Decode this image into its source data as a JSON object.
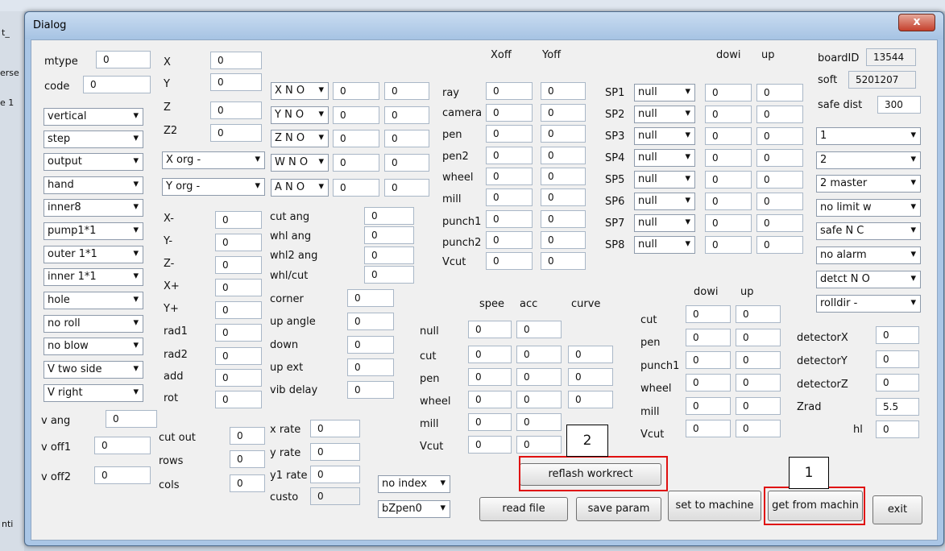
{
  "dialog": {
    "title": "Dialog",
    "close_glyph": "x"
  },
  "background": {
    "left_texts": [
      "t_",
      "erse",
      "e 1",
      "nti"
    ]
  },
  "colors": {
    "highlight": "#e01010"
  },
  "col1": {
    "mtype_label": "mtype",
    "mtype_value": "0",
    "code_label": "code",
    "code_value": "0",
    "combos": [
      "vertical",
      "step",
      "output",
      "hand",
      "inner8",
      "pump1*1",
      "outer 1*1",
      "inner 1*1",
      "hole",
      "no roll",
      "no blow",
      "V two side",
      "V right"
    ],
    "v_ang_label": "v ang",
    "v_ang_value": "0",
    "v_off1_label": "v off1",
    "v_off1_value": "0",
    "v_off2_label": "v off2",
    "v_off2_value": "0"
  },
  "col2": {
    "x_label": "X",
    "x_value": "0",
    "y_label": "Y",
    "y_value": "0",
    "z_label": "Z",
    "z_value": "0",
    "z2_label": "Z2",
    "z2_value": "0",
    "x_org": "X org -",
    "y_org": "Y org -",
    "rows": [
      {
        "label": "X-",
        "value": "0"
      },
      {
        "label": "Y-",
        "value": "0"
      },
      {
        "label": "Z-",
        "value": "0"
      },
      {
        "label": "X+",
        "value": "0"
      },
      {
        "label": "Y+",
        "value": "0"
      },
      {
        "label": "rad1",
        "value": "0"
      },
      {
        "label": "rad2",
        "value": "0"
      },
      {
        "label": "add",
        "value": "0"
      },
      {
        "label": "rot",
        "value": "0"
      }
    ],
    "cut_out_label": "cut out",
    "cut_out_value": "0",
    "rows_label": "rows",
    "rows_value": "0",
    "cols_label": "cols",
    "cols_value": "0"
  },
  "col3": {
    "no_rows": [
      {
        "combo": "X N O",
        "a": "0",
        "b": "0"
      },
      {
        "combo": "Y N O",
        "a": "0",
        "b": "0"
      },
      {
        "combo": "Z N O",
        "a": "0",
        "b": "0"
      },
      {
        "combo": "W N O",
        "a": "0",
        "b": "0"
      },
      {
        "combo": "A N O",
        "a": "0",
        "b": "0"
      }
    ],
    "angles": [
      {
        "label": "cut ang",
        "value": "0"
      },
      {
        "label": "whl ang",
        "value": "0"
      },
      {
        "label": "whl2 ang",
        "value": "0"
      },
      {
        "label": "whl/cut",
        "value": "0"
      }
    ],
    "params": [
      {
        "label": "corner",
        "value": "0"
      },
      {
        "label": "up angle",
        "value": "0"
      },
      {
        "label": "down",
        "value": "0"
      },
      {
        "label": "up ext",
        "value": "0"
      },
      {
        "label": "vib delay",
        "value": "0"
      }
    ],
    "x_rate_label": "x rate",
    "x_rate_value": "0",
    "y_rate_label": "y rate",
    "y_rate_value": "0",
    "y1_rate_label": "y1 rate",
    "y1_rate_value": "0",
    "custom_label": "custo",
    "custom_value": "0",
    "index_combo": "no index",
    "pen_combo": "bZpen0"
  },
  "offsets": {
    "xoff_header": "Xoff",
    "yoff_header": "Yoff",
    "rows": [
      {
        "label": "ray",
        "x": "0",
        "y": "0"
      },
      {
        "label": "camera",
        "x": "0",
        "y": "0"
      },
      {
        "label": "pen",
        "x": "0",
        "y": "0"
      },
      {
        "label": "pen2",
        "x": "0",
        "y": "0"
      },
      {
        "label": "wheel",
        "x": "0",
        "y": "0"
      },
      {
        "label": "mill",
        "x": "0",
        "y": "0"
      },
      {
        "label": "punch1",
        "x": "0",
        "y": "0"
      },
      {
        "label": "punch2",
        "x": "0",
        "y": "0"
      },
      {
        "label": "Vcut",
        "x": "0",
        "y": "0"
      }
    ]
  },
  "speeds": {
    "spee_header": "spee",
    "acc_header": "acc",
    "curve_header": "curve",
    "rows": [
      {
        "label": "null",
        "spee": "0",
        "acc": "0",
        "curve": ""
      },
      {
        "label": "cut",
        "spee": "0",
        "acc": "0",
        "curve": "0"
      },
      {
        "label": "pen",
        "spee": "0",
        "acc": "0",
        "curve": "0"
      },
      {
        "label": "wheel",
        "spee": "0",
        "acc": "0",
        "curve": "0"
      },
      {
        "label": "mill",
        "spee": "0",
        "acc": "0",
        "curve": ""
      },
      {
        "label": "Vcut",
        "spee": "0",
        "acc": "0",
        "curve": ""
      }
    ]
  },
  "sp": {
    "down_header": "dowi",
    "up_header": "up",
    "rows": [
      {
        "label": "SP1",
        "combo": "null",
        "down": "0",
        "up": "0"
      },
      {
        "label": "SP2",
        "combo": "null",
        "down": "0",
        "up": "0"
      },
      {
        "label": "SP3",
        "combo": "null",
        "down": "0",
        "up": "0"
      },
      {
        "label": "SP4",
        "combo": "null",
        "down": "0",
        "up": "0"
      },
      {
        "label": "SP5",
        "combo": "null",
        "down": "0",
        "up": "0"
      },
      {
        "label": "SP6",
        "combo": "null",
        "down": "0",
        "up": "0"
      },
      {
        "label": "SP7",
        "combo": "null",
        "down": "0",
        "up": "0"
      },
      {
        "label": "SP8",
        "combo": "null",
        "down": "0",
        "up": "0"
      }
    ]
  },
  "tools": {
    "down_header": "dowi",
    "up_header": "up",
    "rows": [
      {
        "label": "cut",
        "down": "0",
        "up": "0"
      },
      {
        "label": "pen",
        "down": "0",
        "up": "0"
      },
      {
        "label": "punch1",
        "down": "0",
        "up": "0"
      },
      {
        "label": "wheel",
        "down": "0",
        "up": "0"
      },
      {
        "label": "mill",
        "down": "0",
        "up": "0"
      },
      {
        "label": "Vcut",
        "down": "0",
        "up": "0"
      }
    ]
  },
  "right": {
    "board_label": "boardID",
    "board_value": "13544",
    "soft_label": "soft",
    "soft_value": "5201207",
    "safe_label": "safe dist",
    "safe_value": "300",
    "combos": [
      "1",
      "2",
      "2 master",
      "no limit w",
      "safe N C",
      "no alarm",
      "detct N O",
      "rolldir -"
    ],
    "detectors": [
      {
        "label": "detectorX",
        "value": "0"
      },
      {
        "label": "detectorY",
        "value": "0"
      },
      {
        "label": "detectorZ",
        "value": "0"
      },
      {
        "label": "Zrad",
        "value": "5.5"
      },
      {
        "label": "hl",
        "value": "0"
      }
    ]
  },
  "buttons": {
    "reflash": "reflash workrect",
    "read_file": "read file",
    "save_param": "save param",
    "set_to_machine": "set to machine",
    "get_from_machine": "get from machin",
    "exit": "exit"
  },
  "callouts": [
    "1",
    "2"
  ]
}
